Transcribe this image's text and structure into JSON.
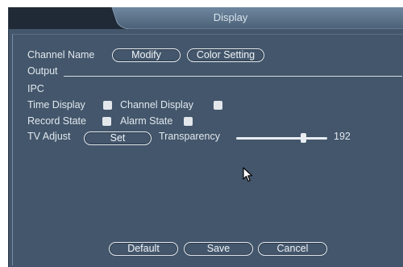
{
  "window": {
    "title": "Display"
  },
  "channel": {
    "label": "Channel Name",
    "modify_btn": "Modify",
    "color_btn": "Color Setting"
  },
  "output": {
    "label": "Output"
  },
  "ipc": {
    "label": "IPC"
  },
  "options": {
    "time_display": "Time Display",
    "channel_display": "Channel Display",
    "record_state": "Record State",
    "alarm_state": "Alarm State"
  },
  "tv_adjust": {
    "label": "TV Adjust",
    "set_btn": "Set"
  },
  "transparency": {
    "label": "Transparency",
    "value": "192",
    "level": 192,
    "max": 255
  },
  "footer": {
    "default_btn": "Default",
    "save_btn": "Save",
    "cancel_btn": "Cancel"
  },
  "colors": {
    "panel": "#43566b",
    "titlebar": "#587088",
    "text": "#e2e8ee"
  }
}
